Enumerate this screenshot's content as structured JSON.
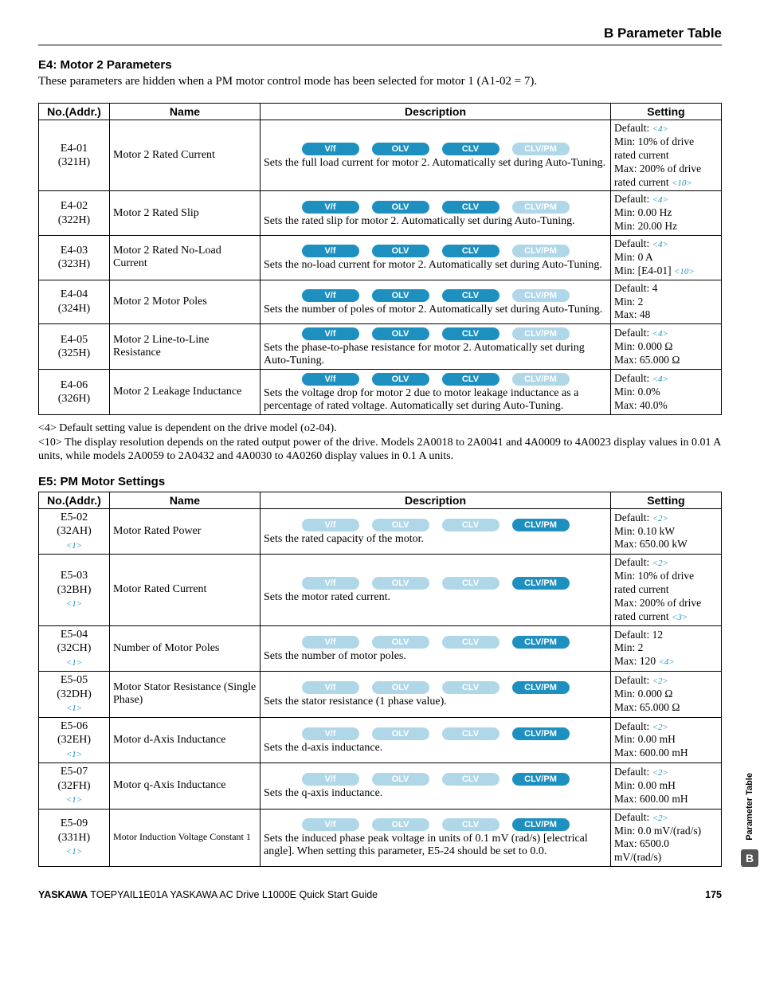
{
  "header": {
    "title": "B  Parameter Table"
  },
  "sections": {
    "e4": {
      "title": "E4: Motor 2 Parameters",
      "lead": "These parameters are hidden when a PM motor control mode has been selected for motor 1 (A1-02 = 7)."
    },
    "e5": {
      "title": "E5: PM Motor Settings"
    }
  },
  "tableHead": {
    "no": "No.(Addr.)",
    "name": "Name",
    "desc": "Description",
    "set": "Setting"
  },
  "tags": {
    "vf": "V/f",
    "olv": "OLV",
    "clv": "CLV",
    "clvpm": "CLV/PM"
  },
  "e4rows": [
    {
      "no1": "E4-01",
      "no2": "(321H)",
      "name": "Motor 2 Rated Current",
      "desc": "Sets the full load current for motor 2. Automatically set during Auto-Tuning.",
      "set": [
        "Default: ",
        "Min: 10% of drive rated current",
        "Max: 200% of drive rated current "
      ],
      "defRef": "<4>",
      "trailRef": "<10>"
    },
    {
      "no1": "E4-02",
      "no2": "(322H)",
      "name": "Motor 2 Rated Slip",
      "desc": "Sets the rated slip for motor 2. Automatically set during Auto-Tuning.",
      "set": [
        "Default: ",
        "Min: 0.00 Hz",
        "Min: 20.00 Hz"
      ],
      "defRef": "<4>"
    },
    {
      "no1": "E4-03",
      "no2": "(323H)",
      "name": "Motor 2 Rated No-Load Current",
      "desc": "Sets the no-load current for motor 2. Automatically set during Auto-Tuning.",
      "set": [
        "Default: ",
        "Min: 0 A",
        "Min: [E4-01]  "
      ],
      "defRef": "<4>",
      "trailRef": "<10>"
    },
    {
      "no1": "E4-04",
      "no2": "(324H)",
      "name": "Motor 2 Motor Poles",
      "desc": "Sets the number of poles of motor 2. Automatically set during Auto-Tuning.",
      "set": [
        "Default: 4",
        "Min: 2",
        "Max: 48"
      ]
    },
    {
      "no1": "E4-05",
      "no2": "(325H)",
      "name": "Motor 2 Line-to-Line Resistance",
      "desc": "Sets the phase-to-phase resistance for motor 2. Automatically set during Auto-Tuning.",
      "set": [
        "Default: ",
        "Min: 0.000 Ω",
        "Max: 65.000 Ω"
      ],
      "defRef": "<4>"
    },
    {
      "no1": "E4-06",
      "no2": "(326H)",
      "name": "Motor 2 Leakage Inductance",
      "desc": "Sets the voltage drop for motor 2 due to motor leakage inductance as a percentage of rated voltage. Automatically set during Auto-Tuning.",
      "set": [
        "Default: ",
        "Min: 0.0%",
        "Max: 40.0%"
      ],
      "defRef": "<4>"
    }
  ],
  "footnotes": {
    "n4": "<4> Default setting value is dependent on the drive model (o2-04).",
    "n10": "<10> The display resolution depends on the rated output power of the drive. Models 2A0018 to 2A0041 and 4A0009 to 4A0023 display values in 0.01 A units, while models 2A0059 to 2A0432 and 4A0030 to 4A0260 display values in 0.1 A units."
  },
  "e5rows": [
    {
      "no1": "E5-02",
      "no2": "(32AH)",
      "noRef": "<1>",
      "name": "Motor Rated Power",
      "desc": "Sets the rated capacity of the motor.",
      "set": [
        "Default: ",
        "Min: 0.10 kW",
        "Max: 650.00 kW"
      ],
      "defRef": "<2>"
    },
    {
      "no1": "E5-03",
      "no2": "(32BH)",
      "noRef": "<1>",
      "name": "Motor Rated Current",
      "desc": "Sets the motor rated current.",
      "set": [
        "Default: ",
        "Min: 10% of drive rated current",
        "Max: 200% of drive rated current "
      ],
      "defRef": "<2>",
      "trailRef": "<3>"
    },
    {
      "no1": "E5-04",
      "no2": "(32CH)",
      "noRef": "<1>",
      "name": "Number of Motor Poles",
      "desc": "Sets the number of motor poles.",
      "set": [
        "Default: 12",
        "Min: 2",
        "Max: 120 "
      ],
      "trailRef": "<4>"
    },
    {
      "no1": "E5-05",
      "no2": "(32DH)",
      "noRef": "<1>",
      "name": "Motor Stator Resistance (Single Phase)",
      "desc": "Sets the stator resistance (1 phase value).",
      "set": [
        "Default: ",
        "Min: 0.000 Ω",
        "Max: 65.000 Ω"
      ],
      "defRef": "<2>"
    },
    {
      "no1": "E5-06",
      "no2": "(32EH)",
      "noRef": "<1>",
      "name": "Motor d-Axis Inductance",
      "desc": "Sets the d-axis inductance.",
      "set": [
        "Default: ",
        "Min: 0.00 mH",
        "Max: 600.00 mH"
      ],
      "defRef": "<2>"
    },
    {
      "no1": "E5-07",
      "no2": "(32FH)",
      "noRef": "<1>",
      "name": "Motor q-Axis Inductance",
      "desc": "Sets the q-axis inductance.",
      "set": [
        "Default: ",
        "Min: 0.00 mH",
        "Max: 600.00 mH"
      ],
      "defRef": "<2>"
    },
    {
      "no1": "E5-09",
      "no2": "(331H)",
      "noRef": "<1>",
      "name": "Motor Induction Voltage Constant 1",
      "smallName": true,
      "desc": "Sets the induced phase peak voltage in units of 0.1 mV (rad/s) [electrical angle]. When setting this parameter, E5-24 should be set to 0.0.",
      "set": [
        "Default: ",
        "Min: 0.0 mV/(rad/s)",
        "Max: 6500.0 mV/(rad/s)"
      ],
      "defRef": "<2>"
    }
  ],
  "footer": {
    "brand": "YASKAWA",
    "doc": " TOEPYAIL1E01A YASKAWA AC Drive L1000E Quick Start Guide",
    "page": "175"
  },
  "sideTab": {
    "label": "Parameter Table",
    "letter": "B"
  }
}
